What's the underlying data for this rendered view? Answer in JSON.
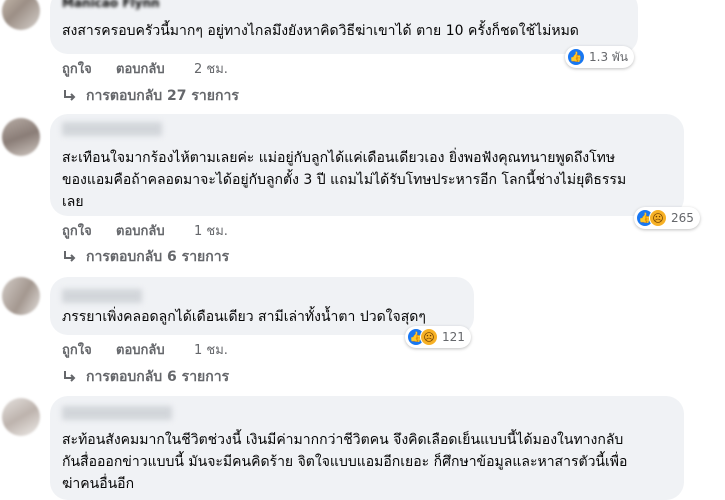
{
  "comments": [
    {
      "author": "Manicao Flynn",
      "lines": [
        "สงสารครอบครัวนี้มากๆ อยู่ทางไกลมึงยังหาคิดวิธีฆ่าเขาได้ ตาย 10 ครั้งก็ชดใช้ไม่หมด"
      ],
      "reaction_count": "1.3 พัน",
      "like_label": "ถูกใจ",
      "reply_label": "ตอบกลับ",
      "time": "2 ชม.",
      "replies_label": "การตอบกลับ 27 รายการ"
    },
    {
      "author": "",
      "lines": [
        "สะเทือนใจมากร้องไห้ตามเลยค่ะ แม่อยู่กับลูกได้แค่เดือนเดียวเอง ยิ่งพอฟังคุณทนายพูดถึงโทษ",
        "ของแอมคือถ้าคลอดมาจะได้อยู่กับลูกตั้ง 3 ปี แถมไม่ได้รับโทษประหารอีก โลกนี้ช่างไม่ยุติธรรม",
        "เลย"
      ],
      "reaction_count": "265",
      "like_label": "ถูกใจ",
      "reply_label": "ตอบกลับ",
      "time": "1 ชม.",
      "replies_label": "การตอบกลับ 6 รายการ"
    },
    {
      "author": "",
      "lines": [
        "ภรรยาเพิ่งคลอดลูกได้เดือนเดียว สามีเล่าทั้งน้ำตา ปวดใจสุดๆ"
      ],
      "reaction_count": "121",
      "like_label": "ถูกใจ",
      "reply_label": "ตอบกลับ",
      "time": "1 ชม.",
      "replies_label": "การตอบกลับ 6 รายการ"
    },
    {
      "author": "",
      "lines": [
        "สะท้อนสังคมมากในชีวิตช่วงนี้ เงินมีค่ามากกว่าชีวิตคน จึงคิดเลือดเย็นแบบนี้ได้มองในทางกลับ",
        "กันสื่อออกข่าวแบบนี้ มันจะมีคนคิดร้าย จิตใจแบบแอมอีกเยอะ ก็ศึกษาข้อมูลและหาสารตัวนี้เพื่อ",
        "ฆ่าคนอื่นอีก"
      ]
    }
  ],
  "colors": {
    "bubble": "#f0f2f5",
    "muted": "#65676b",
    "like": "#1877f2",
    "sad": "#f7b125"
  }
}
